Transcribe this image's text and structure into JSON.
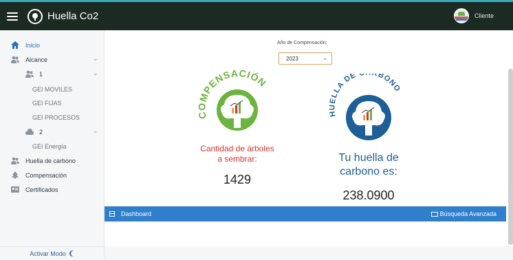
{
  "header": {
    "title": "Huella Co2",
    "user_name": "Cliente"
  },
  "sidebar": {
    "items": [
      {
        "label": "Inicio",
        "icon": "home-icon",
        "active": true
      },
      {
        "label": "Alcance",
        "icon": "users-icon"
      },
      {
        "label": "1",
        "icon": "users-icon"
      },
      {
        "label": "GEI MOVILES"
      },
      {
        "label": "GEI FIJAS"
      },
      {
        "label": "GEI PROCESOS"
      },
      {
        "label": "2",
        "icon": "cloud-icon"
      },
      {
        "label": "GEI Energía"
      },
      {
        "label": "Huella de carbono",
        "icon": "users-icon"
      },
      {
        "label": "Compensación",
        "icon": "tree-icon"
      },
      {
        "label": "Certificados",
        "icon": "id-card-icon"
      }
    ],
    "footer_label": "Activar Modo"
  },
  "main": {
    "year_label": "Año de Compensación:",
    "year_value": "2023",
    "compensacion": {
      "badge_text": "COMPENSACIÓN",
      "caption_line1": "Cantidad de árboles",
      "caption_line2": "a sembrar:",
      "value": "1429"
    },
    "huella": {
      "badge_text": "HUELLA DE CARBONO",
      "caption_line1": "Tu huella de",
      "caption_line2": "carbono es:",
      "value": "238.0900"
    },
    "dashboard_label": "Dashboard",
    "search_label": "Búsqueda Avanzada"
  },
  "colors": {
    "topbar": "#1c2b22",
    "accent_blue": "#2f7fcd",
    "green": "#6cb33f",
    "navy": "#1d5f96",
    "red": "#d9342b"
  }
}
